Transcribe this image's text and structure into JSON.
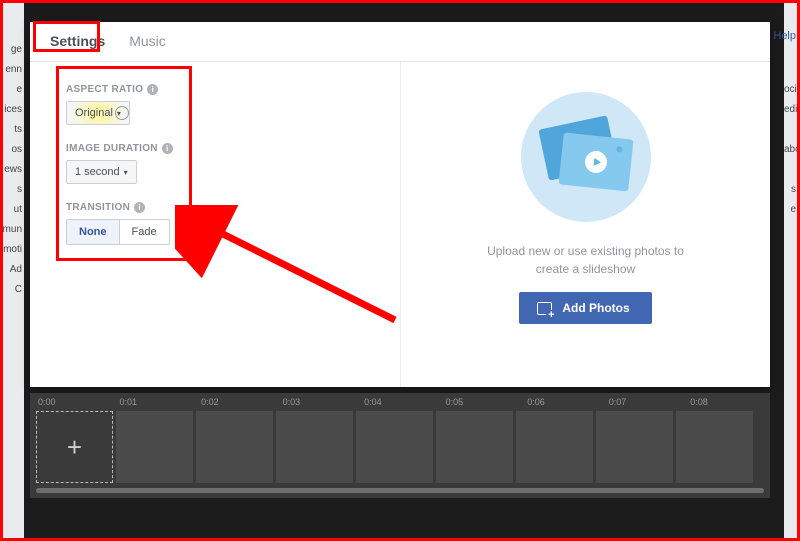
{
  "tabs": {
    "settings": "Settings",
    "music": "Music"
  },
  "settings": {
    "aspect_ratio_label": "ASPECT RATIO",
    "aspect_ratio_value": "Original",
    "image_duration_label": "IMAGE DURATION",
    "image_duration_value": "1 second",
    "transition_label": "TRANSITION",
    "transition_none": "None",
    "transition_fade": "Fade"
  },
  "preview": {
    "instructions": "Upload new or use existing photos to create a slideshow",
    "add_photos": "Add Photos"
  },
  "timeline": {
    "ticks": [
      "0:00",
      "0:01",
      "0:02",
      "0:03",
      "0:04",
      "0:05",
      "0:06",
      "0:07",
      "0:08"
    ],
    "add_label": "+"
  },
  "help": "Help"
}
